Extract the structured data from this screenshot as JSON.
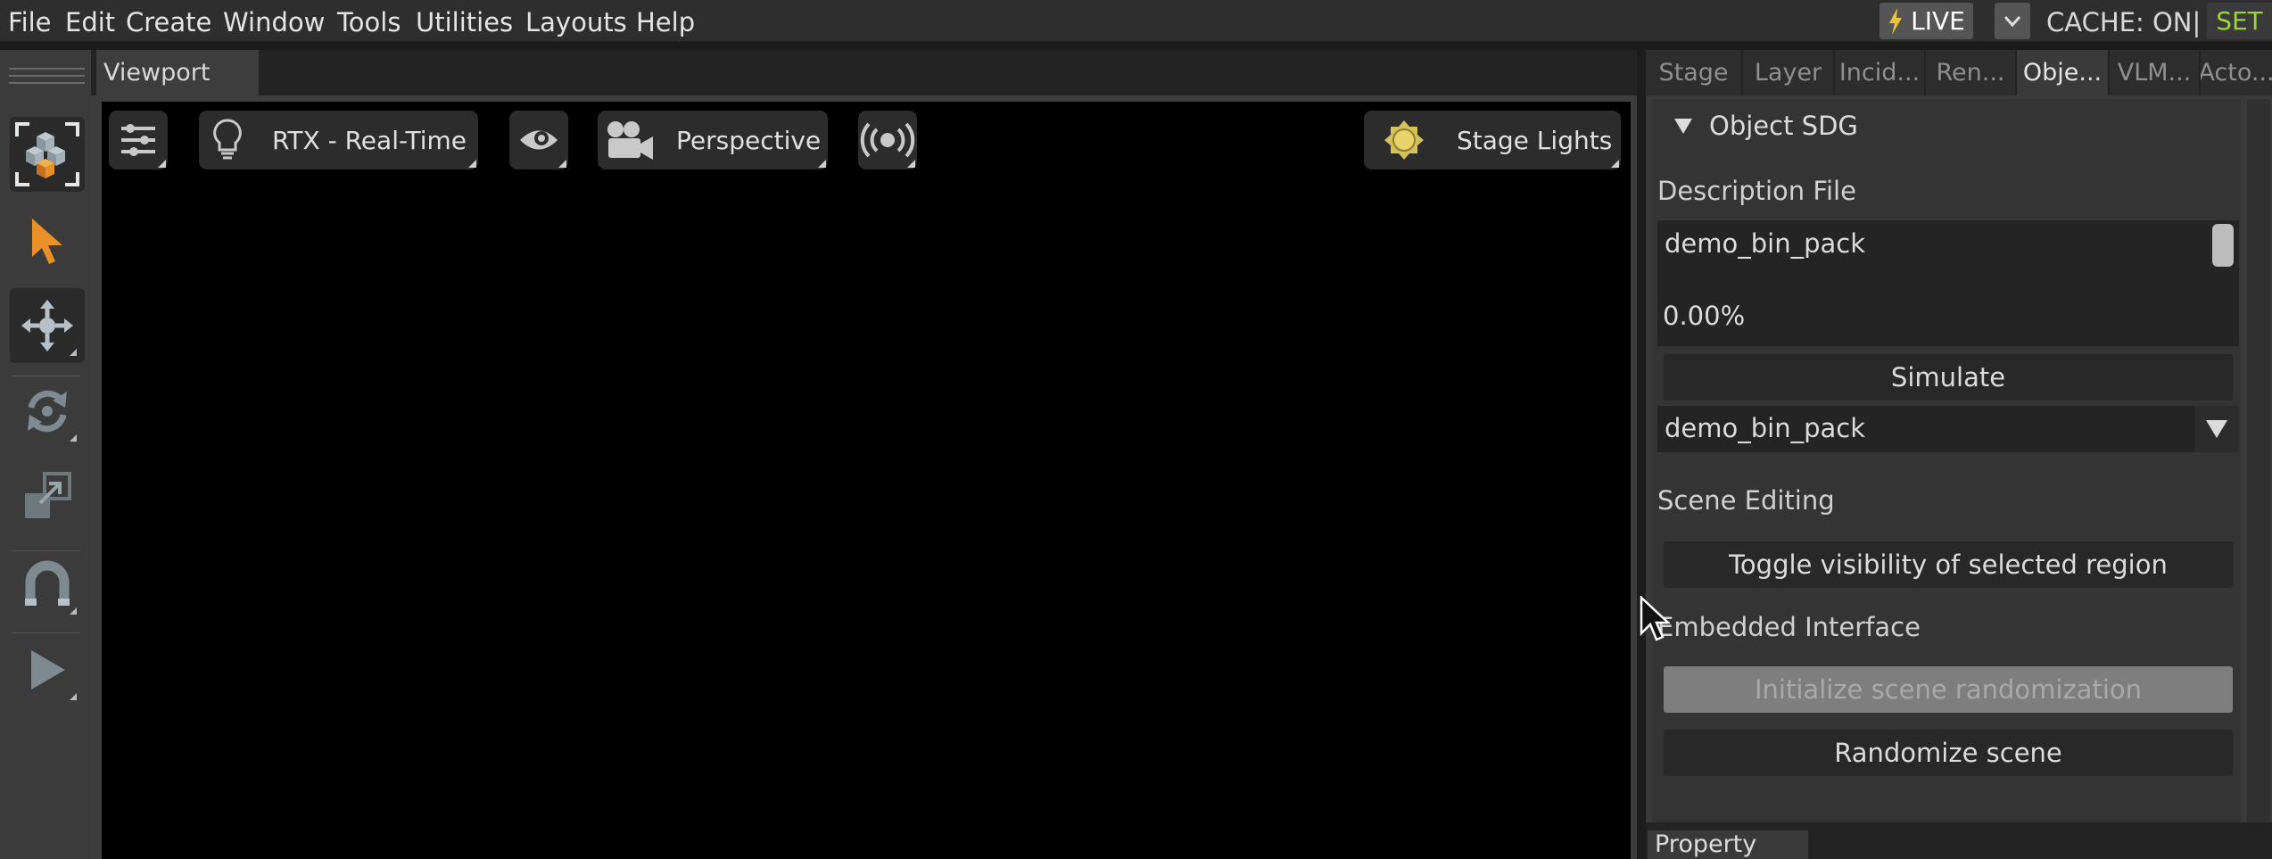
{
  "menubar": {
    "items": [
      "File",
      "Edit",
      "Create",
      "Window",
      "Tools",
      "Utilities",
      "Layouts",
      "Help"
    ],
    "live_label": "LIVE",
    "cache_label": "CACHE: ON|",
    "set_label": "SET",
    "colors": {
      "set_text": "#9bd33b",
      "live_bolt": "#e8c33a"
    }
  },
  "toolbar": {
    "tools": [
      "select-mode-icon",
      "cursor-arrow-icon",
      "move-icon",
      "rotate-icon",
      "scale-icon",
      "snap-magnet-icon",
      "play-icon"
    ],
    "colors": {
      "accent": "#e8902a"
    }
  },
  "viewport": {
    "tab_label": "Viewport",
    "renderer_label": "RTX - Real-Time",
    "camera_label": "Perspective",
    "lights_label": "Stage Lights"
  },
  "right_panel": {
    "tabs": [
      "Stage",
      "Layer",
      "Incid...",
      "Ren...",
      "Obje...",
      "VLM...",
      "Acto..."
    ],
    "active_tab": "Obje...",
    "section_title": "Object SDG",
    "description_file_label": "Description File",
    "description_value": "demo_bin_pack",
    "progress_text": "0.00%",
    "simulate_label": "Simulate",
    "combo_value": "demo_bin_pack",
    "scene_editing_label": "Scene Editing",
    "toggle_visibility_label": "Toggle visibility of selected region",
    "embedded_interface_label": "Embedded Interface",
    "initialize_label": "Initialize scene randomization",
    "randomize_label": "Randomize scene"
  },
  "bottom_panel": {
    "tab_label": "Property"
  }
}
